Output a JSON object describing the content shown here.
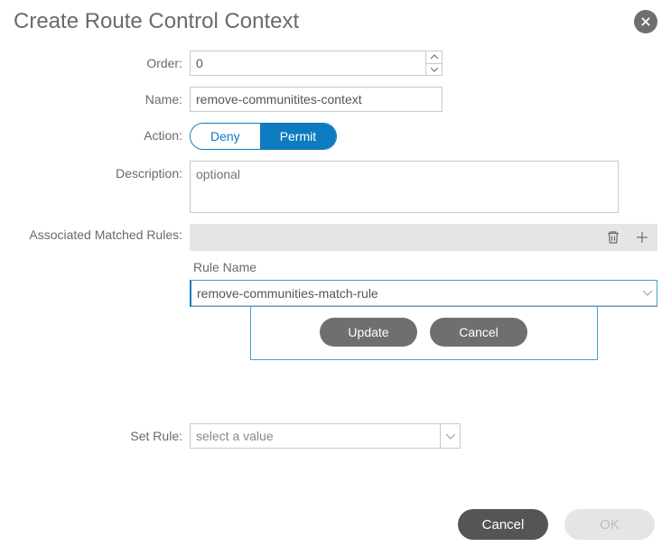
{
  "dialog": {
    "title": "Create Route Control Context"
  },
  "form": {
    "order": {
      "label": "Order:",
      "value": "0"
    },
    "name": {
      "label": "Name:",
      "value": "remove-communitites-context"
    },
    "action": {
      "label": "Action:",
      "deny": "Deny",
      "permit": "Permit",
      "selected": "permit"
    },
    "description": {
      "label": "Description:",
      "placeholder": "optional",
      "value": ""
    }
  },
  "amr": {
    "label": "Associated Matched Rules:",
    "column_header": "Rule Name",
    "selected_rule": "remove-communities-match-rule",
    "actions": {
      "update": "Update",
      "cancel": "Cancel"
    },
    "icons": {
      "trash": "trash-icon",
      "plus": "plus-icon"
    }
  },
  "set_rule": {
    "label": "Set Rule:",
    "placeholder": "select a value"
  },
  "footer": {
    "cancel": "Cancel",
    "ok": "OK"
  }
}
